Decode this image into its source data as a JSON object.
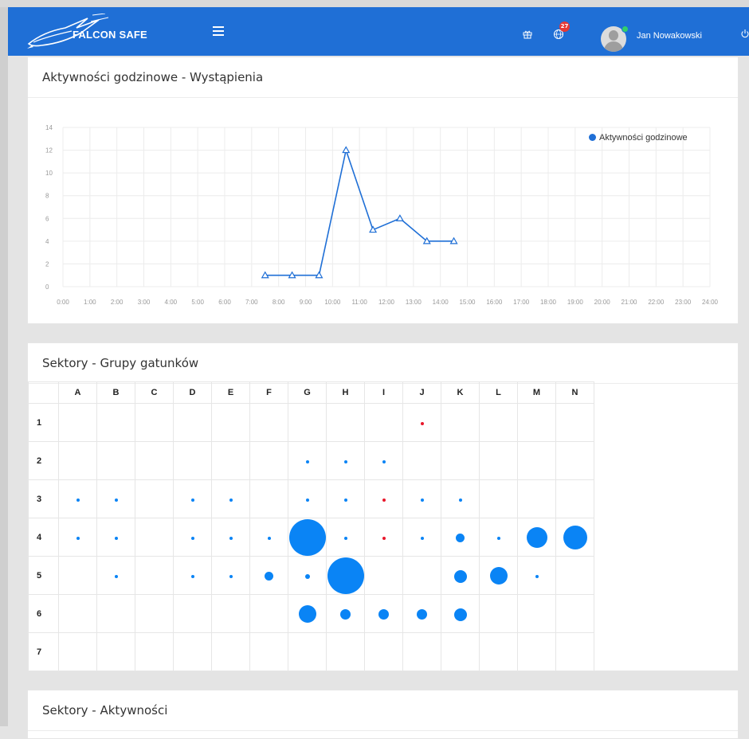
{
  "header": {
    "brand": "FALCON SAFE",
    "user_name": "Jan Nowakowski",
    "notification_count": "27",
    "icons": [
      "falcon-logo-icon",
      "menu-icon",
      "gift-icon",
      "globe-icon",
      "power-icon"
    ]
  },
  "chart_card": {
    "title": "Aktywności godzinowe - Wystąpienia",
    "legend_label": "Aktywności godzinowe"
  },
  "chart_data": {
    "type": "line",
    "series": [
      {
        "name": "Aktywności godzinowe",
        "color": "#1f6fd6",
        "marker": "triangle",
        "x": [
          "7:30",
          "8:30",
          "9:30",
          "10:30",
          "11:30",
          "12:30",
          "13:30",
          "14:30"
        ],
        "y": [
          1,
          1,
          1,
          12,
          5,
          6,
          4,
          4
        ]
      }
    ],
    "x_ticks": [
      "0:00",
      "1:00",
      "2:00",
      "3:00",
      "4:00",
      "5:00",
      "6:00",
      "7:00",
      "8:00",
      "9:00",
      "10:00",
      "11:00",
      "12:00",
      "13:00",
      "14:00",
      "15:00",
      "16:00",
      "17:00",
      "18:00",
      "19:00",
      "20:00",
      "21:00",
      "22:00",
      "23:00",
      "24:00"
    ],
    "y_ticks": [
      "0",
      "2",
      "4",
      "6",
      "8",
      "10",
      "12",
      "14"
    ],
    "ylim": [
      0,
      14
    ],
    "grid": true,
    "legend_position": "top-right"
  },
  "sectors_card": {
    "title": "Sektory - Grupy gatunków",
    "columns": [
      "A",
      "B",
      "C",
      "D",
      "E",
      "F",
      "G",
      "H",
      "I",
      "J",
      "K",
      "L",
      "M",
      "N"
    ],
    "rows": [
      "1",
      "2",
      "3",
      "4",
      "5",
      "6",
      "7"
    ],
    "bubble_colors": {
      "blue": "#0a84f5",
      "red": "#e8172b"
    },
    "bubbles": [
      {
        "row": "1",
        "col": "J",
        "size": "dot",
        "color": "red"
      },
      {
        "row": "2",
        "col": "G",
        "size": "dot",
        "color": "blue"
      },
      {
        "row": "2",
        "col": "H",
        "size": "dot",
        "color": "blue"
      },
      {
        "row": "2",
        "col": "I",
        "size": "dot",
        "color": "blue"
      },
      {
        "row": "3",
        "col": "A",
        "size": "dot",
        "color": "blue"
      },
      {
        "row": "3",
        "col": "B",
        "size": "dot",
        "color": "blue"
      },
      {
        "row": "3",
        "col": "D",
        "size": "dot",
        "color": "blue"
      },
      {
        "row": "3",
        "col": "E",
        "size": "dot",
        "color": "blue"
      },
      {
        "row": "3",
        "col": "G",
        "size": "dot",
        "color": "blue"
      },
      {
        "row": "3",
        "col": "H",
        "size": "dot",
        "color": "blue"
      },
      {
        "row": "3",
        "col": "I",
        "size": "dot",
        "color": "red"
      },
      {
        "row": "3",
        "col": "J",
        "size": "dot",
        "color": "blue"
      },
      {
        "row": "3",
        "col": "K",
        "size": "dot",
        "color": "blue"
      },
      {
        "row": "4",
        "col": "A",
        "size": "dot",
        "color": "blue"
      },
      {
        "row": "4",
        "col": "B",
        "size": "dot",
        "color": "blue"
      },
      {
        "row": "4",
        "col": "D",
        "size": "dot",
        "color": "blue"
      },
      {
        "row": "4",
        "col": "E",
        "size": "dot",
        "color": "blue"
      },
      {
        "row": "4",
        "col": "F",
        "size": "dot",
        "color": "blue"
      },
      {
        "row": "4",
        "col": "G",
        "size": "xl",
        "color": "blue"
      },
      {
        "row": "4",
        "col": "H",
        "size": "dot",
        "color": "blue"
      },
      {
        "row": "4",
        "col": "I",
        "size": "dot",
        "color": "red"
      },
      {
        "row": "4",
        "col": "J",
        "size": "dot",
        "color": "blue"
      },
      {
        "row": "4",
        "col": "K",
        "size": "sm",
        "color": "blue"
      },
      {
        "row": "4",
        "col": "L",
        "size": "dot",
        "color": "blue"
      },
      {
        "row": "4",
        "col": "M",
        "size": "lg",
        "color": "blue"
      },
      {
        "row": "4",
        "col": "N",
        "size": "lg2",
        "color": "blue"
      },
      {
        "row": "5",
        "col": "B",
        "size": "dot",
        "color": "blue"
      },
      {
        "row": "5",
        "col": "D",
        "size": "dot",
        "color": "blue"
      },
      {
        "row": "5",
        "col": "E",
        "size": "dot",
        "color": "blue"
      },
      {
        "row": "5",
        "col": "F",
        "size": "sm",
        "color": "blue"
      },
      {
        "row": "5",
        "col": "G",
        "size": "dot2",
        "color": "blue"
      },
      {
        "row": "5",
        "col": "H",
        "size": "xl",
        "color": "blue"
      },
      {
        "row": "5",
        "col": "K",
        "size": "md",
        "color": "blue"
      },
      {
        "row": "5",
        "col": "L",
        "size": "md2",
        "color": "blue"
      },
      {
        "row": "5",
        "col": "M",
        "size": "dot",
        "color": "blue"
      },
      {
        "row": "6",
        "col": "G",
        "size": "md2",
        "color": "blue"
      },
      {
        "row": "6",
        "col": "H",
        "size": "sm2",
        "color": "blue"
      },
      {
        "row": "6",
        "col": "I",
        "size": "sm2",
        "color": "blue"
      },
      {
        "row": "6",
        "col": "J",
        "size": "sm2",
        "color": "blue"
      },
      {
        "row": "6",
        "col": "K",
        "size": "md",
        "color": "blue"
      }
    ]
  },
  "activities_card": {
    "title": "Sektory - Aktywności"
  }
}
